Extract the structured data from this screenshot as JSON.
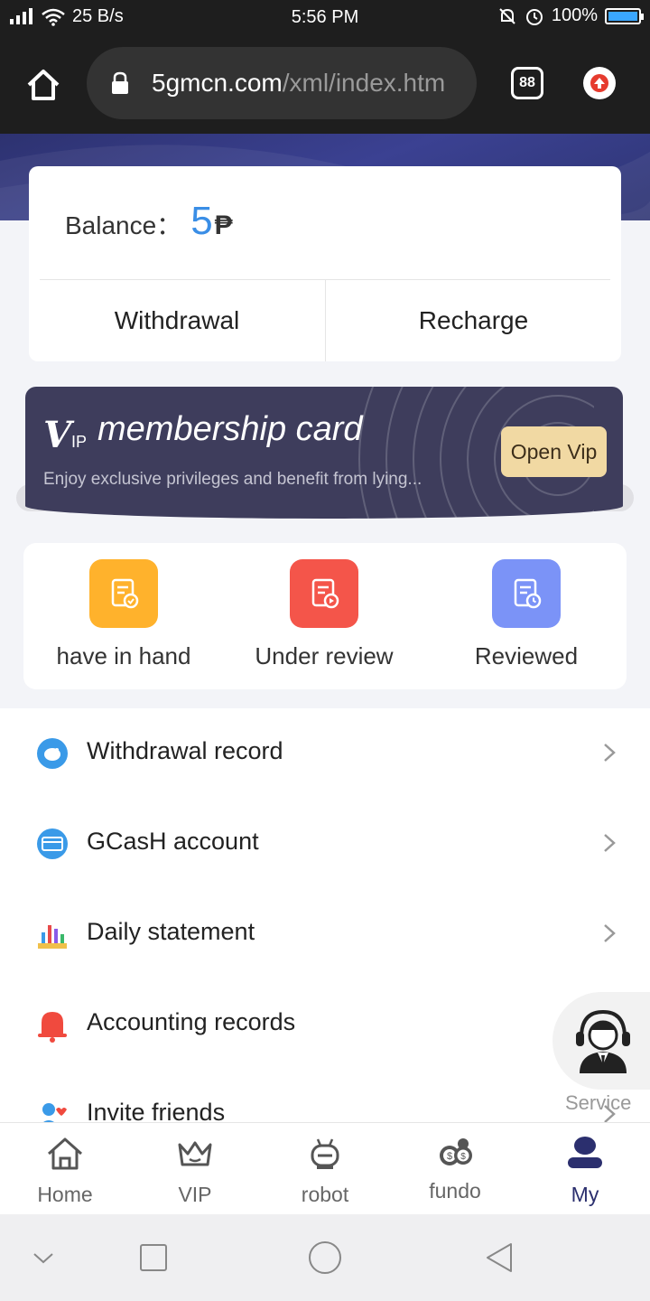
{
  "status_bar": {
    "network": "25 B/s",
    "time": "5:56 PM",
    "battery": "100%"
  },
  "browser": {
    "url_domain": "5gmcn.com",
    "url_path": "/xml/index.htm",
    "tab_count": "88"
  },
  "balance": {
    "label": "Balance：",
    "value": "5",
    "currency": "₱",
    "withdraw_label": "Withdrawal",
    "recharge_label": "Recharge"
  },
  "vip": {
    "logo_v": "V",
    "logo_ip": "IP",
    "title": "membership card",
    "subtitle": "Enjoy exclusive privileges and benefit from lying...",
    "button": "Open Vip"
  },
  "status_tiles": [
    {
      "label": "have in hand",
      "color": "#ffb22c"
    },
    {
      "label": "Under review",
      "color": "#f4554a"
    },
    {
      "label": "Reviewed",
      "color": "#7b93f7"
    }
  ],
  "menu": [
    {
      "label": "Withdrawal record",
      "icon": "piggy-bank-icon"
    },
    {
      "label": "GCasH account",
      "icon": "card-icon"
    },
    {
      "label": "Daily statement",
      "icon": "bar-chart-icon"
    },
    {
      "label": "Accounting records",
      "icon": "bell-icon"
    },
    {
      "label": "Invite friends",
      "icon": "invite-icon"
    }
  ],
  "service": {
    "label": "Service"
  },
  "bottom_nav": [
    {
      "label": "Home",
      "icon": "home-icon"
    },
    {
      "label": "VIP",
      "icon": "crown-icon"
    },
    {
      "label": "robot",
      "icon": "robot-icon"
    },
    {
      "label": "fundo",
      "icon": "coins-icon"
    },
    {
      "label": "My",
      "icon": "user-icon",
      "active": true
    }
  ],
  "colors": {
    "accent": "#3a8ee6",
    "header": "#2d3270",
    "vip_card": "#3e3d5c",
    "vip_button": "#f1d9a3"
  }
}
